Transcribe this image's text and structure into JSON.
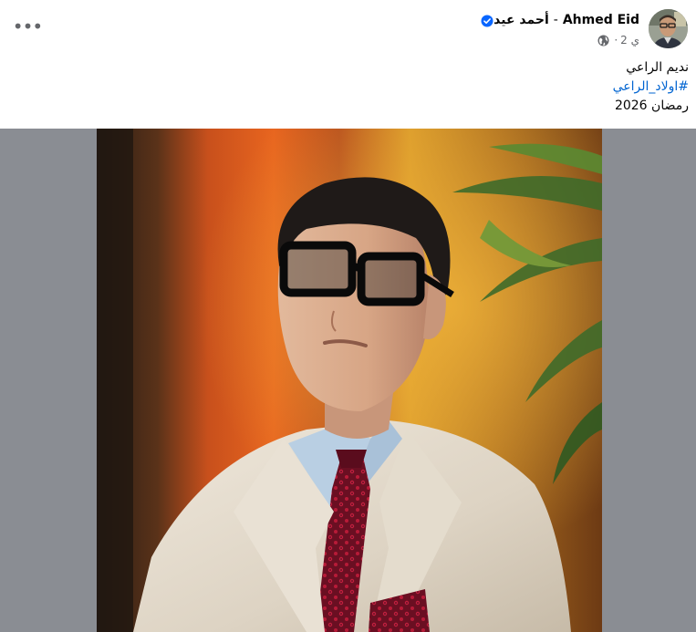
{
  "post": {
    "author_name": "Ahmed Eid",
    "author_separator": "-",
    "author_name_ar": "أحمد عيد",
    "time": "2 ي",
    "meta_separator": "·",
    "more_label": "•••",
    "text_lines": {
      "line1": "نديم الراعي",
      "hashtag": "#اولاد_الراعي",
      "line3": "رمضان 2026"
    }
  },
  "colors": {
    "link": "#0064d1",
    "verified_badge": "#0866ff",
    "media_background": "#8a8d93",
    "secondary_text": "#65676b"
  },
  "icons": {
    "more": "more-horizontal-icon",
    "verified": "verified-badge-icon",
    "audience": "globe-icon"
  }
}
